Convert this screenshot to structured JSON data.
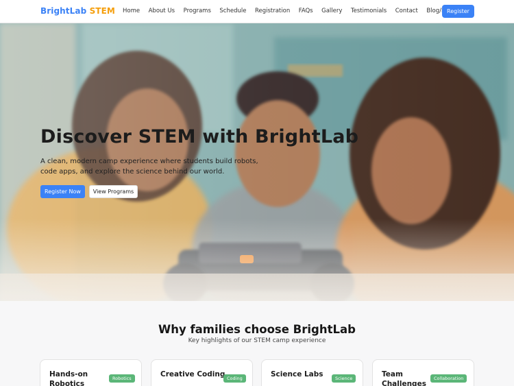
{
  "brand": {
    "part1": "BrightLab",
    "part2": "STEM"
  },
  "nav": {
    "items": [
      "Home",
      "About Us",
      "Programs",
      "Schedule",
      "Registration",
      "FAQs",
      "Gallery",
      "Testimonials",
      "Contact",
      "Blog/News"
    ],
    "register_label": "Register"
  },
  "hero": {
    "title": "Discover STEM with BrightLab",
    "subtitle": "A clean, modern camp experience where students build robots, code apps, and explore the science behind our world.",
    "primary_label": "Register Now",
    "secondary_label": "View Programs"
  },
  "features": {
    "title": "Why families choose BrightLab",
    "subtitle": "Key highlights of our STEM camp experience",
    "cards": [
      {
        "title": "Hands-on Robotics",
        "badge": "Robotics"
      },
      {
        "title": "Creative Coding",
        "badge": "Coding"
      },
      {
        "title": "Science Labs",
        "badge": "Science"
      },
      {
        "title": "Team Challenges",
        "badge": "Collaboration"
      }
    ]
  },
  "colors": {
    "primary": "#3b82f6",
    "accent": "#f59e0b",
    "badge": "#5bb678"
  }
}
